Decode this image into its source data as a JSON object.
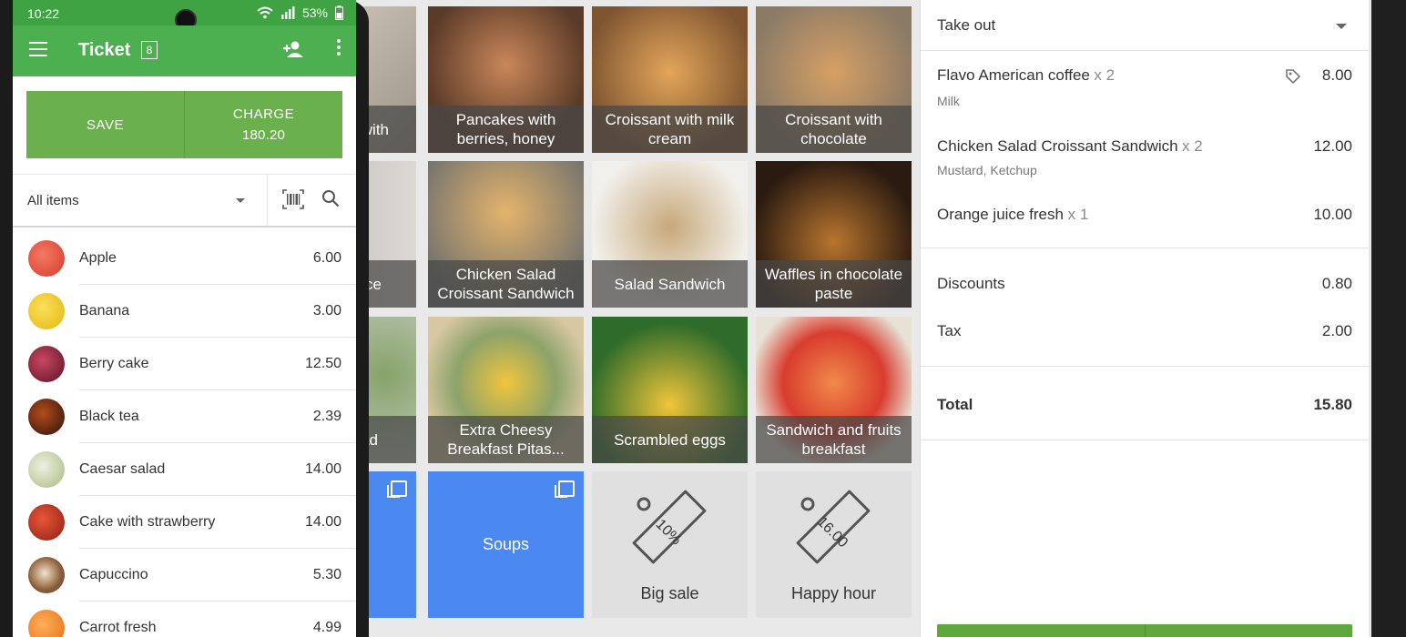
{
  "phone": {
    "status": {
      "time": "10:22",
      "battery": "53%"
    },
    "appbar": {
      "title": "Ticket",
      "ticket_count": "8"
    },
    "buttons": {
      "save": "SAVE",
      "charge": "CHARGE",
      "charge_amount": "180.20"
    },
    "filter": {
      "selected": "All items"
    },
    "items": [
      {
        "name": "Apple",
        "price": "6.00",
        "color": "#e84b3c"
      },
      {
        "name": "Banana",
        "price": "3.00",
        "color": "#f2c21a"
      },
      {
        "name": "Berry cake",
        "price": "12.50",
        "color": "#8e1f3d"
      },
      {
        "name": "Black tea",
        "price": "2.39",
        "color": "#5a2b14"
      },
      {
        "name": "Caesar salad",
        "price": "14.00",
        "color": "#c8d7a8"
      },
      {
        "name": "Cake with strawberry",
        "price": "14.00",
        "color": "#c73b2b"
      },
      {
        "name": "Capuccino",
        "price": "5.30",
        "color": "#c19a6b"
      },
      {
        "name": "Carrot fresh",
        "price": "4.99",
        "color": "#f08a2a"
      }
    ]
  },
  "grid": {
    "tiles": [
      {
        "label": "with",
        "color": "#b9b3a6"
      },
      {
        "label": "Pancakes with berries, honey",
        "color": "#6d4f3c"
      },
      {
        "label": "Croissant with milk cream",
        "color": "#c48b43"
      },
      {
        "label": "Croissant with chocolate",
        "color": "#a3713d"
      },
      {
        "label": "ce",
        "color": "#a9a5a0"
      },
      {
        "label": "Chicken Salad Croissant Sandwich",
        "color": "#c39a5e"
      },
      {
        "label": "Salad Sandwich",
        "color": "#b7a686"
      },
      {
        "label": "Waffles in chocolate paste",
        "color": "#7a4a22"
      },
      {
        "label": "ad",
        "color": "#b2b6a8"
      },
      {
        "label": "Extra Cheesy Breakfast Pitas...",
        "color": "#b8a36a"
      },
      {
        "label": "Scrambled eggs",
        "color": "#a3b34b"
      },
      {
        "label": "Sandwich and fruits breakfast",
        "color": "#c86b4b"
      }
    ],
    "categories": [
      {
        "label": "d"
      },
      {
        "label": "Soups"
      }
    ],
    "discounts": [
      {
        "tag": "10%",
        "label": "Big sale"
      },
      {
        "tag": "16.00",
        "label": "Happy hour"
      }
    ]
  },
  "order": {
    "dining": "Take out",
    "lines": [
      {
        "name": "Flavo American coffee",
        "qty": "x 2",
        "amount": "8.00",
        "note": "Milk"
      },
      {
        "name": "Chicken Salad Croissant Sandwich",
        "qty": "x 2",
        "amount": "12.00",
        "note": "Mustard, Ketchup"
      },
      {
        "name": "Orange juice fresh ",
        "qty": "x 1",
        "amount": "10.00",
        "note": ""
      }
    ],
    "discounts_label": "Discounts",
    "discounts_value": "0.80",
    "tax_label": "Tax",
    "tax_value": "2.00",
    "total_label": "Total",
    "total_value": "15.80"
  }
}
